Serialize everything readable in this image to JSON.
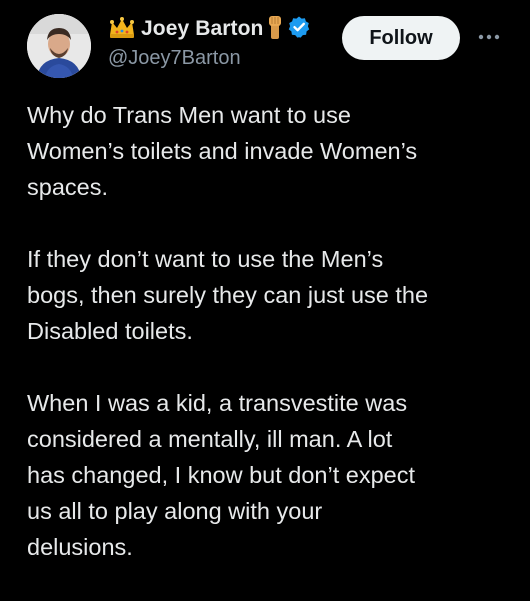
{
  "author": {
    "display_name": "Joey Barton",
    "handle": "@Joey7Barton",
    "leading_emoji": "crown-icon",
    "trailing_emoji": "raised-fist-icon",
    "verified": true,
    "verified_color": "#1d9bf0"
  },
  "follow_label": "Follow",
  "more_icon": "more-icon",
  "paragraphs": [
    "Why do Trans Men want to use\nWomen’s toilets and invade Women’s\nspaces.",
    "If they don’t want to use the Men’s\nbogs, then surely they can just use the\nDisabled toilets.",
    "When I was a kid, a transvestite was\nconsidered a mentally, ill man. A lot\nhas changed, I know but don’t expect\nus all to play along with your\ndelusions."
  ],
  "colors": {
    "background": "#000000",
    "text": "#e7e9ea",
    "secondary": "#8b98a5",
    "button_bg": "#eff3f4",
    "button_text": "#0f1419"
  }
}
